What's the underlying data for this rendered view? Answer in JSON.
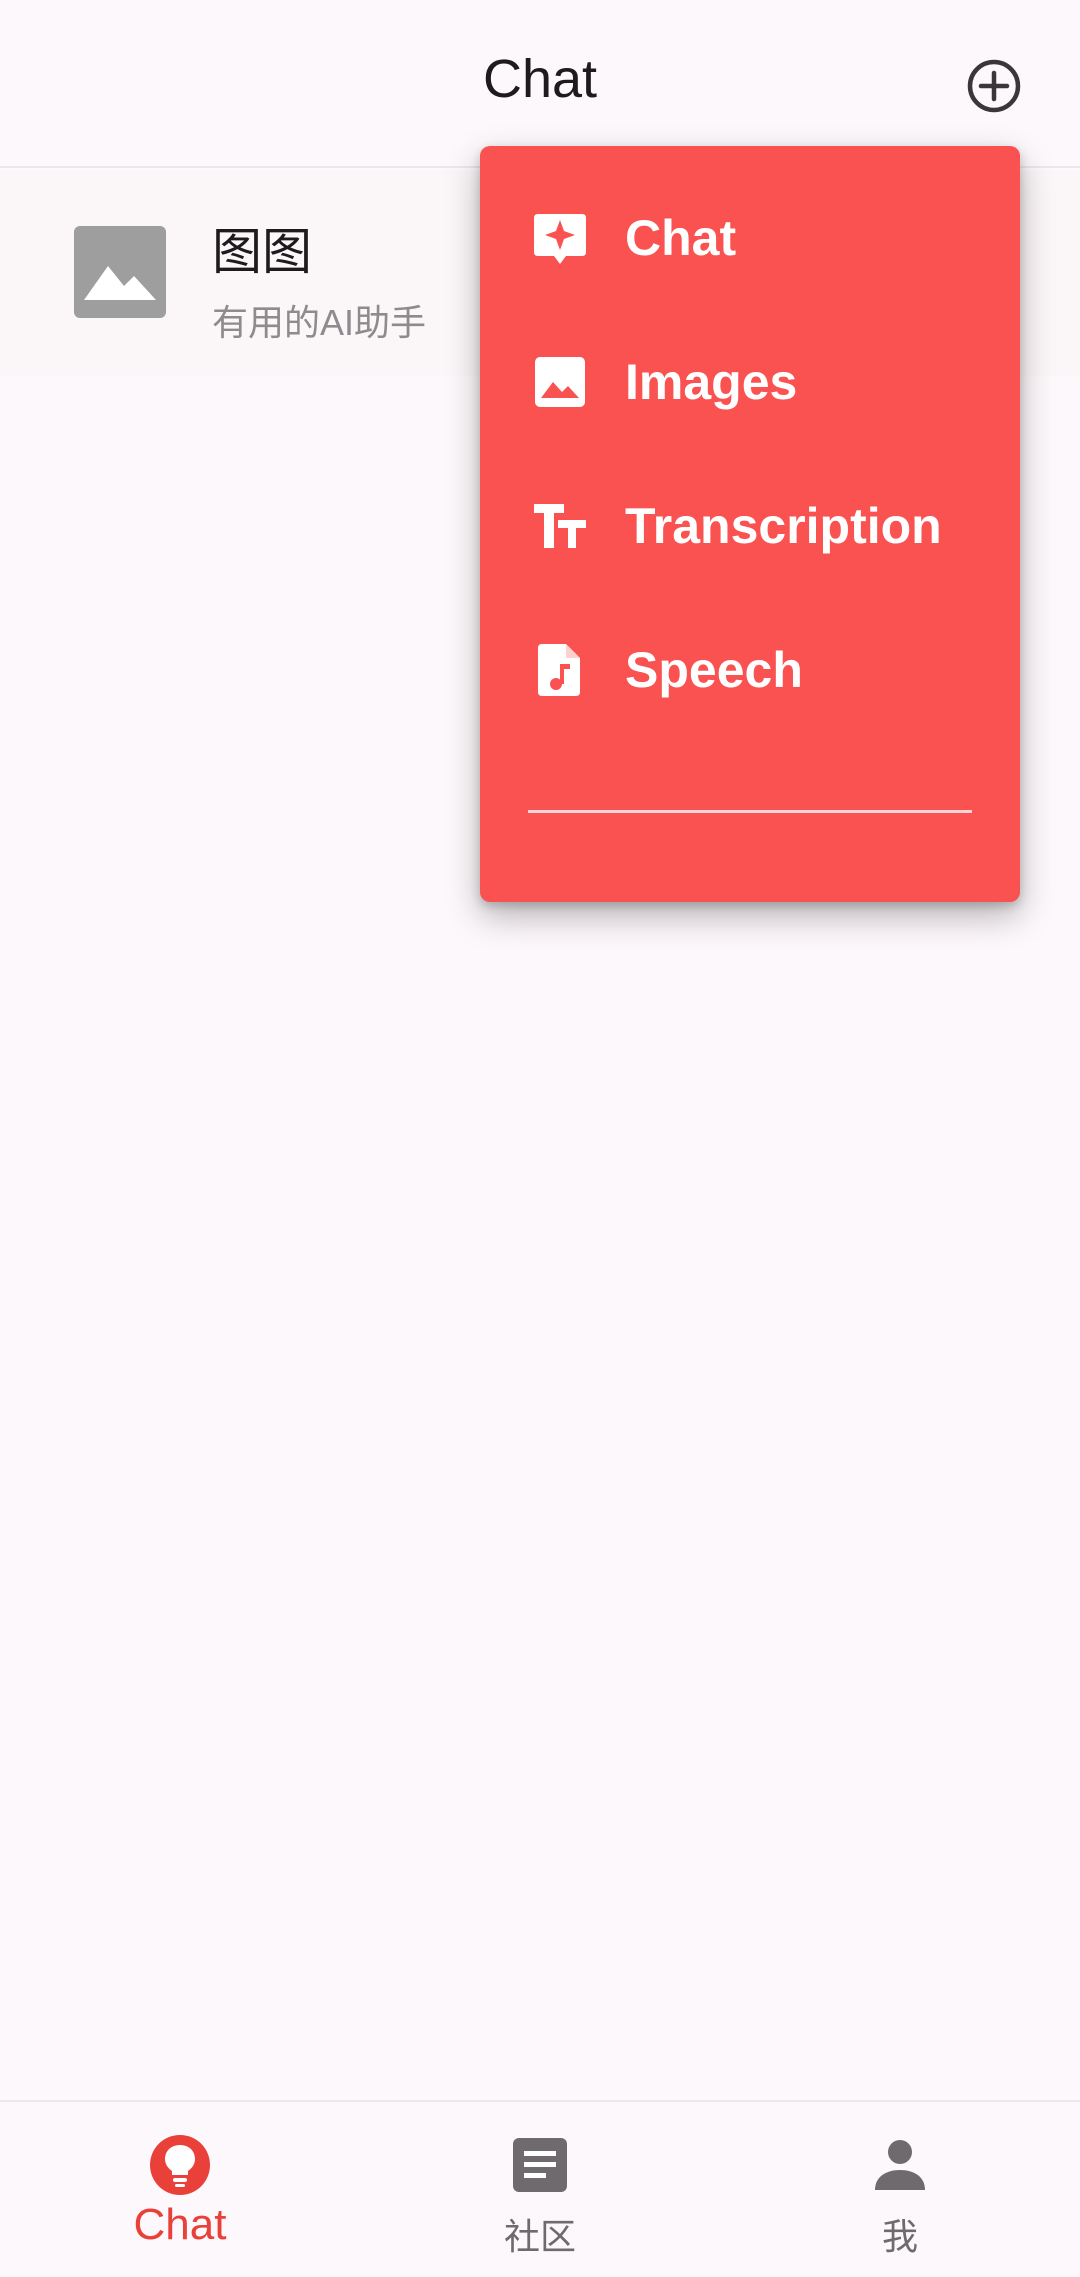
{
  "header": {
    "title": "Chat",
    "add_icon": "add-circle-icon"
  },
  "conversations": [
    {
      "title": "图图",
      "subtitle": "有用的AI助手",
      "avatar_icon": "image-placeholder-icon"
    }
  ],
  "menu": {
    "background": "#fa5151",
    "items": [
      {
        "label": "Chat",
        "icon": "sparkle-chat-icon"
      },
      {
        "label": "Images",
        "icon": "image-icon"
      },
      {
        "label": "Transcription",
        "icon": "text-size-icon"
      },
      {
        "label": "Speech",
        "icon": "audio-file-icon"
      }
    ]
  },
  "bottom_nav": {
    "active_index": 0,
    "accent": "#e9403a",
    "items": [
      {
        "label": "Chat",
        "icon": "lightbulb-icon"
      },
      {
        "label": "社区",
        "icon": "article-icon"
      },
      {
        "label": "我",
        "icon": "person-icon"
      }
    ]
  }
}
